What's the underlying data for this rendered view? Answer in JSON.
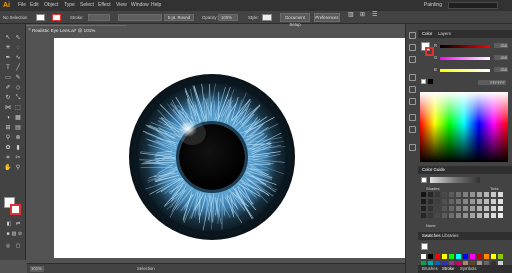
{
  "app": {
    "logo": "Ai"
  },
  "menu": [
    "File",
    "Edit",
    "Object",
    "Type",
    "Select",
    "Effect",
    "View",
    "Window",
    "Help"
  ],
  "workspace": "Painting",
  "control_bar": {
    "selection_label": "No Selection",
    "stroke_label": "Stroke:",
    "brush_label": "5 pt. Round",
    "opacity_label": "Opacity:",
    "opacity_value": "100%",
    "style_label": "Style:",
    "document_setup": "Document Setup",
    "preferences": "Preferences"
  },
  "document_tab": {
    "title": "Realistic Eye Lens.ai* @ 101% (RGB/Preview)",
    "close": "×"
  },
  "status_bar": {
    "zoom": "101%",
    "tool": "Selection"
  },
  "color_panel": {
    "tabs": [
      "Color",
      "Layers"
    ],
    "sliders": [
      {
        "label": "R",
        "value": "255",
        "color": "#ff0000"
      },
      {
        "label": "G",
        "value": "255",
        "color": "#00ff00"
      },
      {
        "label": "B",
        "value": "255",
        "color": "#0000ff"
      }
    ],
    "hex_value": "FFFFFF"
  },
  "color_guide_panel": {
    "tabs": [
      "Color Guide"
    ],
    "shades_label": "Shades",
    "tints_label": "Tints",
    "none_label": "None"
  },
  "swatches_panel": {
    "tabs": [
      "Swatches",
      "Libraries"
    ]
  },
  "bottom_tabs": [
    "Brushes",
    "Stroke",
    "Symbols"
  ],
  "colors": {
    "menubar": "#323232",
    "panel": "#434343",
    "pasteboard": "#535353",
    "iris_light": "#7cc4ee",
    "iris_dark": "#1b2f3d"
  }
}
